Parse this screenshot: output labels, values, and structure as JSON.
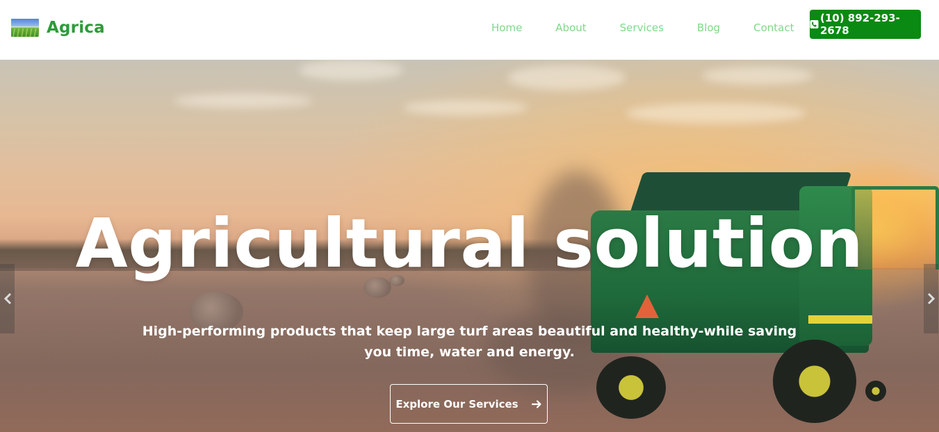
{
  "brand": {
    "name": "Agrica",
    "logo_icon": "field-logo-icon"
  },
  "nav": {
    "items": [
      {
        "label": "Home"
      },
      {
        "label": "About"
      },
      {
        "label": "Services"
      },
      {
        "label": "Blog"
      },
      {
        "label": "Contact"
      }
    ],
    "phone": {
      "label": "(10) 892-293-2678",
      "icon": "phone-icon"
    }
  },
  "hero": {
    "title": "Agricultural solution",
    "subtitle": "High-performing products that keep large turf areas beautiful and healthy-while saving you time, water and energy.",
    "cta_label": "Explore Our Services",
    "cta_icon": "arrow-right-icon",
    "prev_icon": "chevron-left-icon",
    "next_icon": "chevron-right-icon"
  },
  "colors": {
    "brand": "#2e9b3a",
    "nav_link": "#7fd88a",
    "phone_button": "#0a8a12"
  }
}
